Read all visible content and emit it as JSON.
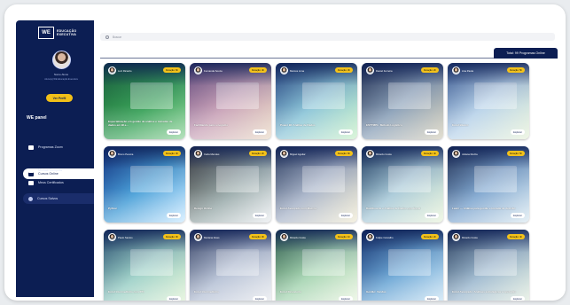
{
  "brand": {
    "logo_mark": "WE",
    "logo_text_line1": "EDUCAÇÃO",
    "logo_text_line2": "EXECUTIVA"
  },
  "user": {
    "name": "Nome Aluno",
    "role": "Aluno(a) WE Educação Executiva",
    "profile_button": "Ver Perfil"
  },
  "sidebar": {
    "panel_title": "WE panel",
    "items": [
      {
        "label": "Programas Zoom",
        "icon": "monitor-icon",
        "state": "normal"
      },
      {
        "label": "Cursos Online",
        "icon": "play-icon",
        "state": "active"
      },
      {
        "label": "Minhas Compras",
        "icon": "cart-icon",
        "state": "normal"
      },
      {
        "label": "Meus Certificados",
        "icon": "certificate-icon",
        "state": "normal"
      },
      {
        "label": "Cursos Salvos",
        "icon": "dot-icon",
        "state": "soft"
      }
    ]
  },
  "search": {
    "placeholder": "Buscar"
  },
  "tabs": {
    "total": "Total: 99 Programas Online"
  },
  "colors": {
    "navy": "#0c1e53",
    "badge": "#f4c21a",
    "background": "#e9ecef"
  },
  "cards": [
    {
      "instructor": "Luiz Ricardo",
      "badge": "Duração: 6h",
      "title": "Especialização em gestão de análise e tomadas de dados em BI e...",
      "button": "Explorar",
      "bg": "linear-gradient(135deg,#1d6b3a,#3aa25a 55%,#8fd29a)"
    },
    {
      "instructor": "Fernanda Souza",
      "badge": "Duração: 4h",
      "title": "Facilitando para o negócio",
      "button": "Explorar",
      "bg": "linear-gradient(135deg,#7a5a8a,#c9a3b8 50%,#e9d9c5)"
    },
    {
      "instructor": "Marcos Lima",
      "badge": "Duração: 3h",
      "title": "Power BI: Análise de Dados",
      "button": "Explorar",
      "bg": "linear-gradient(135deg,#2f4f8a,#8cc5d8 50%,#c9f0c8)"
    },
    {
      "instructor": "Daniel Ferreira",
      "badge": "Duração: 2h",
      "title": "ESTTMPL: Método Logístico",
      "button": "Explorar",
      "bg": "linear-gradient(135deg,#2e3b5b,#8aa0b8 50%,#d3cdb9)"
    },
    {
      "instructor": "Ana Paula",
      "badge": "Duração: 5h",
      "title": "Excel Básico",
      "button": "Explorar",
      "bg": "linear-gradient(135deg,#4a6aa0,#b9d3ea 50%,#e6f1d8)"
    },
    {
      "instructor": "Bruno Pereira",
      "badge": "Duração: 3h",
      "title": "Python",
      "button": "Explorar",
      "bg": "linear-gradient(135deg,#173a8a,#4aa0d8 50%,#c8e8ff)"
    },
    {
      "instructor": "Carla Mendes",
      "badge": "Duração: 2h",
      "title": "Design Online",
      "button": "Explorar",
      "bg": "linear-gradient(135deg,#444,#9aa 55%,#e9ecef)"
    },
    {
      "instructor": "Miguel Aguilar",
      "badge": "Duração: 6h",
      "title": "Excel Avançado com Macros",
      "button": "Explorar",
      "bg": "linear-gradient(135deg,#3b4b6b,#a7b3c8 50%,#f0ead2)"
    },
    {
      "instructor": "Ricardo Costa",
      "badge": "Duração: 4h",
      "title": "Dashboards e Análise de Dados com Excel",
      "button": "Explorar",
      "bg": "linear-gradient(135deg,#2c4a6b,#a8c9d8 50%,#e8f3d9)"
    },
    {
      "instructor": "Juliana Rocha",
      "badge": "Duração: 5h",
      "title": "Learn — Análise para gestão e tomada de decisão",
      "button": "Explorar",
      "bg": "linear-gradient(135deg,#2a3a5c,#7fa6cf 50%,#d9e8f0)"
    },
    {
      "instructor": "Paulo Santos",
      "badge": "Duração: 3h",
      "title": "Excel Intermediário com IPN",
      "button": "Explorar",
      "bg": "linear-gradient(135deg,#355e7a,#9ed1c8 50%,#e3f3d6)"
    },
    {
      "instructor": "Mariana Alves",
      "badge": "Duração: 3h",
      "title": "Excel Intermediário",
      "button": "Explorar",
      "bg": "linear-gradient(135deg,#4b5675,#b7c2d6 50%,#e9ebef)"
    },
    {
      "instructor": "Ricardo Costa",
      "badge": "Duração: 1h",
      "title": "Excel Financeiro",
      "button": "Explorar",
      "bg": "linear-gradient(135deg,#3f6f55,#a7d5b3 50%,#ecf5e2)"
    },
    {
      "instructor": "Felipe Carvalho",
      "badge": "Duração: 2h",
      "title": "Gestão: Vendas",
      "button": "Explorar",
      "bg": "linear-gradient(135deg,#1c3d7a,#6ea8d6 50%,#cfe6f5)"
    },
    {
      "instructor": "Ricardo Costa",
      "badge": "Duração: 4h",
      "title": "Excel Avançado: Análises estratégicas e operação",
      "button": "Explorar",
      "bg": "linear-gradient(135deg,#384e6a,#9fbad0 50%,#e6efe0)"
    }
  ]
}
